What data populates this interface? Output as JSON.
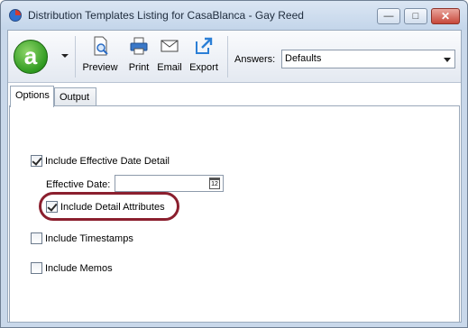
{
  "window": {
    "title": "Distribution Templates Listing for CasaBlanca - Gay Reed"
  },
  "titlebar_buttons": {
    "minimize": "—",
    "maximize": "□",
    "close": "✕"
  },
  "toolbar": {
    "logo_letter": "a",
    "buttons": [
      {
        "label": "Preview",
        "icon": "preview-icon"
      },
      {
        "label": "Print",
        "icon": "printer-icon"
      },
      {
        "label": "Email",
        "icon": "email-icon"
      },
      {
        "label": "Export",
        "icon": "export-icon"
      }
    ],
    "answers_label": "Answers:",
    "answers_value": "Defaults"
  },
  "tabs": [
    {
      "label": "Options",
      "active": true
    },
    {
      "label": "Output",
      "active": false
    }
  ],
  "options": {
    "include_effective_date_detail": {
      "label": "Include Effective Date Detail",
      "checked": true
    },
    "effective_date_label": "Effective Date:",
    "effective_date_value": "",
    "calendar_day": "12",
    "include_detail_attributes": {
      "label": "Include Detail Attributes",
      "checked": true
    },
    "include_timestamps": {
      "label": "Include Timestamps",
      "checked": false
    },
    "include_memos": {
      "label": "Include Memos",
      "checked": false
    }
  },
  "colors": {
    "highlight": "#8b1f2e",
    "logo": "#2f9a20",
    "window_frame": "#c9d8ea"
  }
}
